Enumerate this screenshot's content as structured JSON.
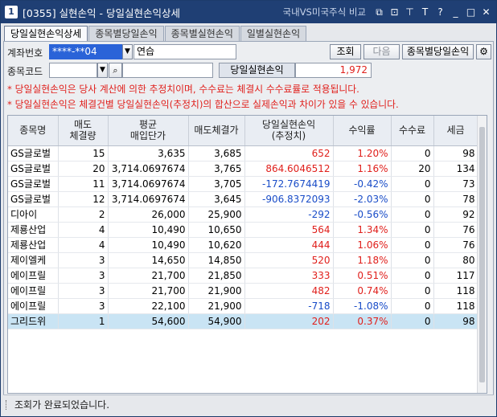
{
  "window": {
    "number": "1",
    "title": "[0355] 실현손익 - 당일실현손익상세",
    "compare_link": "국내VS미국주식 비교",
    "controls": [
      "link-icon",
      "copy-icon",
      "pin-icon",
      "text-icon",
      "help-icon",
      "minimize-icon",
      "maximize-icon",
      "close-icon"
    ],
    "controls_glyphs": [
      "⧉",
      "⊡",
      "⊤",
      "T",
      "?",
      "_",
      "□",
      "✕"
    ]
  },
  "tabs": [
    {
      "label": "당일실현손익상세",
      "active": true
    },
    {
      "label": "종목별당일손익",
      "active": false
    },
    {
      "label": "종목별실현손익",
      "active": false
    },
    {
      "label": "일별실현손익",
      "active": false
    }
  ],
  "form": {
    "account_label": "계좌번호",
    "account_value": "****-**04",
    "account_name": "연습",
    "query_button": "조회",
    "next_button": "다음",
    "stock_daily_button": "종목별당일손익",
    "stock_code_label": "종목코드",
    "stock_code_value": "",
    "daily_pnl_label": "당일실현손익",
    "daily_pnl_value": "1,972"
  },
  "notes": [
    "* 당일실현손익은 당사 계산에 의한 추정치이며, 수수료는 체결시 수수료률로 적용됩니다.",
    "* 당일실현손익은 체결건별 당일실현손익(추정치)의 합산으로 실제손익과 차이가 있을 수 있습니다."
  ],
  "table": {
    "headers": [
      {
        "line1": "종목명",
        "line2": ""
      },
      {
        "line1": "매도",
        "line2": "체결량"
      },
      {
        "line1": "평균",
        "line2": "매입단가"
      },
      {
        "line1": "매도체결가",
        "line2": ""
      },
      {
        "line1": "당일실현손익",
        "line2": "(추정치)"
      },
      {
        "line1": "수익률",
        "line2": ""
      },
      {
        "line1": "수수료",
        "line2": ""
      },
      {
        "line1": "세금",
        "line2": ""
      }
    ],
    "rows": [
      {
        "name": "GS글로벌",
        "qty": "15",
        "avg": "3,635",
        "sell": "3,685",
        "pnl": "652",
        "rate": "1.20%",
        "fee": "0",
        "tax": "98",
        "dir": "up"
      },
      {
        "name": "GS글로벌",
        "qty": "20",
        "avg": "3,714.0697674",
        "sell": "3,765",
        "pnl": "864.6046512",
        "rate": "1.16%",
        "fee": "20",
        "tax": "134",
        "dir": "up"
      },
      {
        "name": "GS글로벌",
        "qty": "11",
        "avg": "3,714.0697674",
        "sell": "3,705",
        "pnl": "-172.7674419",
        "rate": "-0.42%",
        "fee": "0",
        "tax": "73",
        "dir": "down"
      },
      {
        "name": "GS글로벌",
        "qty": "12",
        "avg": "3,714.0697674",
        "sell": "3,645",
        "pnl": "-906.8372093",
        "rate": "-2.03%",
        "fee": "0",
        "tax": "78",
        "dir": "down"
      },
      {
        "name": "디아이",
        "qty": "2",
        "avg": "26,000",
        "sell": "25,900",
        "pnl": "-292",
        "rate": "-0.56%",
        "fee": "0",
        "tax": "92",
        "dir": "down"
      },
      {
        "name": "제룡산업",
        "qty": "4",
        "avg": "10,490",
        "sell": "10,650",
        "pnl": "564",
        "rate": "1.34%",
        "fee": "0",
        "tax": "76",
        "dir": "up"
      },
      {
        "name": "제룡산업",
        "qty": "4",
        "avg": "10,490",
        "sell": "10,620",
        "pnl": "444",
        "rate": "1.06%",
        "fee": "0",
        "tax": "76",
        "dir": "up"
      },
      {
        "name": "제이엘케",
        "qty": "3",
        "avg": "14,650",
        "sell": "14,850",
        "pnl": "520",
        "rate": "1.18%",
        "fee": "0",
        "tax": "80",
        "dir": "up"
      },
      {
        "name": "에이프릴",
        "qty": "3",
        "avg": "21,700",
        "sell": "21,850",
        "pnl": "333",
        "rate": "0.51%",
        "fee": "0",
        "tax": "117",
        "dir": "up"
      },
      {
        "name": "에이프릴",
        "qty": "3",
        "avg": "21,700",
        "sell": "21,900",
        "pnl": "482",
        "rate": "0.74%",
        "fee": "0",
        "tax": "118",
        "dir": "up"
      },
      {
        "name": "에이프릴",
        "qty": "3",
        "avg": "22,100",
        "sell": "21,900",
        "pnl": "-718",
        "rate": "-1.08%",
        "fee": "0",
        "tax": "118",
        "dir": "down"
      },
      {
        "name": "그리드위",
        "qty": "1",
        "avg": "54,600",
        "sell": "54,900",
        "pnl": "202",
        "rate": "0.37%",
        "fee": "0",
        "tax": "98",
        "dir": "up",
        "selected": true
      }
    ]
  },
  "status": {
    "message": "조회가 완료되었습니다."
  },
  "colors": {
    "titlebar": "#1f3f74",
    "positive": "#e0201c",
    "negative": "#1a4dc8",
    "selected_row": "#c9e4f4",
    "account_highlight": "#2a63d8"
  }
}
